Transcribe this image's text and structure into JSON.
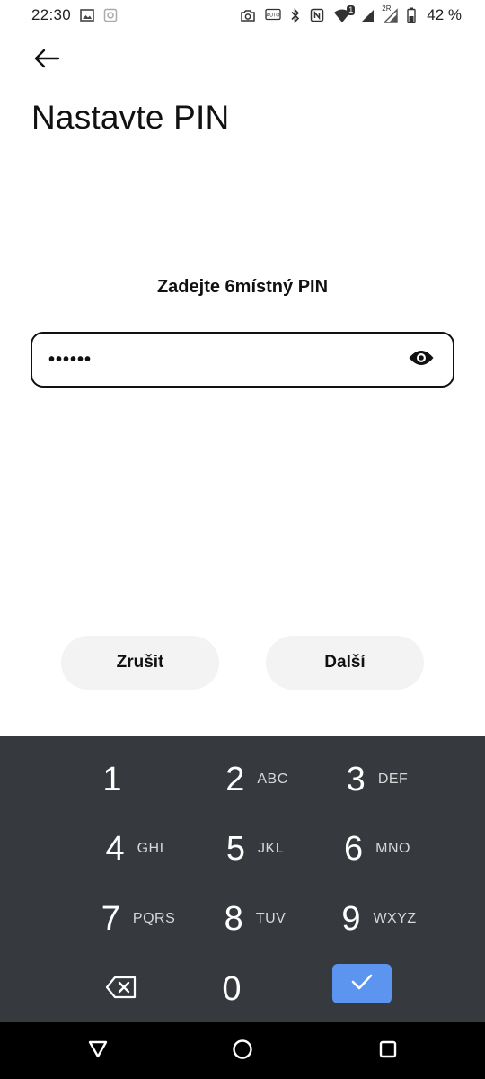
{
  "status_bar": {
    "time": "22:30",
    "battery_text": "42 %",
    "icons_left": [
      "image-icon",
      "screenshot-icon"
    ],
    "icons_right": [
      "camera-icon",
      "auto-brightness-icon",
      "bluetooth-icon",
      "nfc-icon",
      "wifi-icon",
      "signal-icon",
      "signal-2-icon",
      "battery-icon"
    ],
    "wifi_badge": "1",
    "signal_badge": "2R"
  },
  "header": {
    "title": "Nastavte PIN"
  },
  "pin": {
    "prompt": "Zadejte 6místný PIN",
    "value": "••••••"
  },
  "actions": {
    "cancel_label": "Zrušit",
    "next_label": "Další"
  },
  "keypad": {
    "keys": [
      {
        "digit": "1",
        "letters": ""
      },
      {
        "digit": "2",
        "letters": "ABC"
      },
      {
        "digit": "3",
        "letters": "DEF"
      },
      {
        "digit": "4",
        "letters": "GHI"
      },
      {
        "digit": "5",
        "letters": "JKL"
      },
      {
        "digit": "6",
        "letters": "MNO"
      },
      {
        "digit": "7",
        "letters": "PQRS"
      },
      {
        "digit": "8",
        "letters": "TUV"
      },
      {
        "digit": "9",
        "letters": "WXYZ"
      },
      {
        "digit": "0",
        "letters": ""
      }
    ],
    "accent_color": "#5b95f0",
    "background_color": "#363a3e"
  }
}
